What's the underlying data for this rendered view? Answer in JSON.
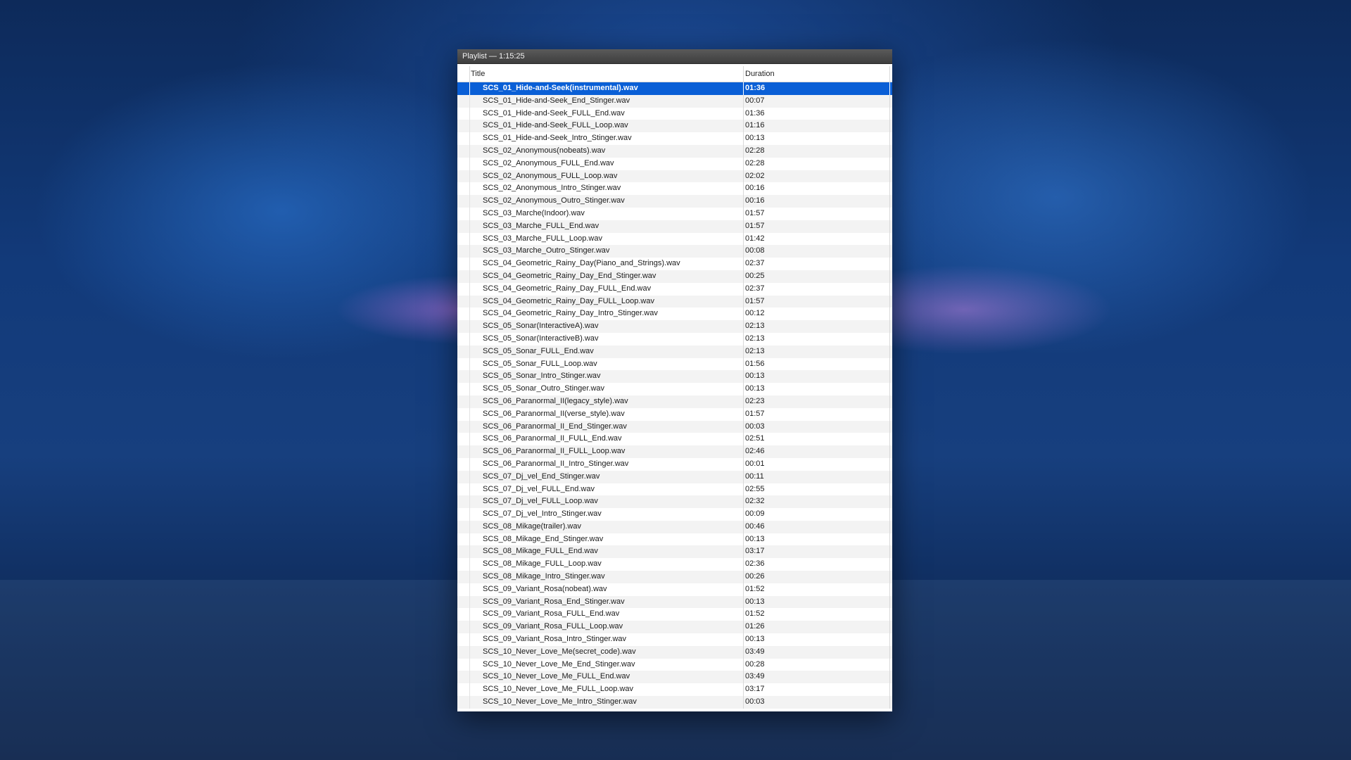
{
  "window": {
    "title": "Playlist — 1:15:25"
  },
  "columns": {
    "title": "Title",
    "duration": "Duration"
  },
  "selected_index": 0,
  "tracks": [
    {
      "title": "SCS_01_Hide-and-Seek(instrumental).wav",
      "duration": "01:36"
    },
    {
      "title": "SCS_01_Hide-and-Seek_End_Stinger.wav",
      "duration": "00:07"
    },
    {
      "title": "SCS_01_Hide-and-Seek_FULL_End.wav",
      "duration": "01:36"
    },
    {
      "title": "SCS_01_Hide-and-Seek_FULL_Loop.wav",
      "duration": "01:16"
    },
    {
      "title": "SCS_01_Hide-and-Seek_Intro_Stinger.wav",
      "duration": "00:13"
    },
    {
      "title": "SCS_02_Anonymous(nobeats).wav",
      "duration": "02:28"
    },
    {
      "title": "SCS_02_Anonymous_FULL_End.wav",
      "duration": "02:28"
    },
    {
      "title": "SCS_02_Anonymous_FULL_Loop.wav",
      "duration": "02:02"
    },
    {
      "title": "SCS_02_Anonymous_Intro_Stinger.wav",
      "duration": "00:16"
    },
    {
      "title": "SCS_02_Anonymous_Outro_Stinger.wav",
      "duration": "00:16"
    },
    {
      "title": "SCS_03_Marche(Indoor).wav",
      "duration": "01:57"
    },
    {
      "title": "SCS_03_Marche_FULL_End.wav",
      "duration": "01:57"
    },
    {
      "title": "SCS_03_Marche_FULL_Loop.wav",
      "duration": "01:42"
    },
    {
      "title": "SCS_03_Marche_Outro_Stinger.wav",
      "duration": "00:08"
    },
    {
      "title": "SCS_04_Geometric_Rainy_Day(Piano_and_Strings).wav",
      "duration": "02:37"
    },
    {
      "title": "SCS_04_Geometric_Rainy_Day_End_Stinger.wav",
      "duration": "00:25"
    },
    {
      "title": "SCS_04_Geometric_Rainy_Day_FULL_End.wav",
      "duration": "02:37"
    },
    {
      "title": "SCS_04_Geometric_Rainy_Day_FULL_Loop.wav",
      "duration": "01:57"
    },
    {
      "title": "SCS_04_Geometric_Rainy_Day_Intro_Stinger.wav",
      "duration": "00:12"
    },
    {
      "title": "SCS_05_Sonar(InteractiveA).wav",
      "duration": "02:13"
    },
    {
      "title": "SCS_05_Sonar(InteractiveB).wav",
      "duration": "02:13"
    },
    {
      "title": "SCS_05_Sonar_FULL_End.wav",
      "duration": "02:13"
    },
    {
      "title": "SCS_05_Sonar_FULL_Loop.wav",
      "duration": "01:56"
    },
    {
      "title": "SCS_05_Sonar_Intro_Stinger.wav",
      "duration": "00:13"
    },
    {
      "title": "SCS_05_Sonar_Outro_Stinger.wav",
      "duration": "00:13"
    },
    {
      "title": "SCS_06_Paranormal_II(legacy_style).wav",
      "duration": "02:23"
    },
    {
      "title": "SCS_06_Paranormal_II(verse_style).wav",
      "duration": "01:57"
    },
    {
      "title": "SCS_06_Paranormal_II_End_Stinger.wav",
      "duration": "00:03"
    },
    {
      "title": "SCS_06_Paranormal_II_FULL_End.wav",
      "duration": "02:51"
    },
    {
      "title": "SCS_06_Paranormal_II_FULL_Loop.wav",
      "duration": "02:46"
    },
    {
      "title": "SCS_06_Paranormal_II_Intro_Stinger.wav",
      "duration": "00:01"
    },
    {
      "title": "SCS_07_Dj_vel_End_Stinger.wav",
      "duration": "00:11"
    },
    {
      "title": "SCS_07_Dj_vel_FULL_End.wav",
      "duration": "02:55"
    },
    {
      "title": "SCS_07_Dj_vel_FULL_Loop.wav",
      "duration": "02:32"
    },
    {
      "title": "SCS_07_Dj_vel_Intro_Stinger.wav",
      "duration": "00:09"
    },
    {
      "title": "SCS_08_Mikage(trailer).wav",
      "duration": "00:46"
    },
    {
      "title": "SCS_08_Mikage_End_Stinger.wav",
      "duration": "00:13"
    },
    {
      "title": "SCS_08_Mikage_FULL_End.wav",
      "duration": "03:17"
    },
    {
      "title": "SCS_08_Mikage_FULL_Loop.wav",
      "duration": "02:36"
    },
    {
      "title": "SCS_08_Mikage_Intro_Stinger.wav",
      "duration": "00:26"
    },
    {
      "title": "SCS_09_Variant_Rosa(nobeat).wav",
      "duration": "01:52"
    },
    {
      "title": "SCS_09_Variant_Rosa_End_Stinger.wav",
      "duration": "00:13"
    },
    {
      "title": "SCS_09_Variant_Rosa_FULL_End.wav",
      "duration": "01:52"
    },
    {
      "title": "SCS_09_Variant_Rosa_FULL_Loop.wav",
      "duration": "01:26"
    },
    {
      "title": "SCS_09_Variant_Rosa_Intro_Stinger.wav",
      "duration": "00:13"
    },
    {
      "title": "SCS_10_Never_Love_Me(secret_code).wav",
      "duration": "03:49"
    },
    {
      "title": "SCS_10_Never_Love_Me_End_Stinger.wav",
      "duration": "00:28"
    },
    {
      "title": "SCS_10_Never_Love_Me_FULL_End.wav",
      "duration": "03:49"
    },
    {
      "title": "SCS_10_Never_Love_Me_FULL_Loop.wav",
      "duration": "03:17"
    },
    {
      "title": "SCS_10_Never_Love_Me_Intro_Stinger.wav",
      "duration": "00:03"
    }
  ],
  "colors": {
    "selection": "#0a5fd6",
    "titlebar": "#4a4a4a"
  }
}
